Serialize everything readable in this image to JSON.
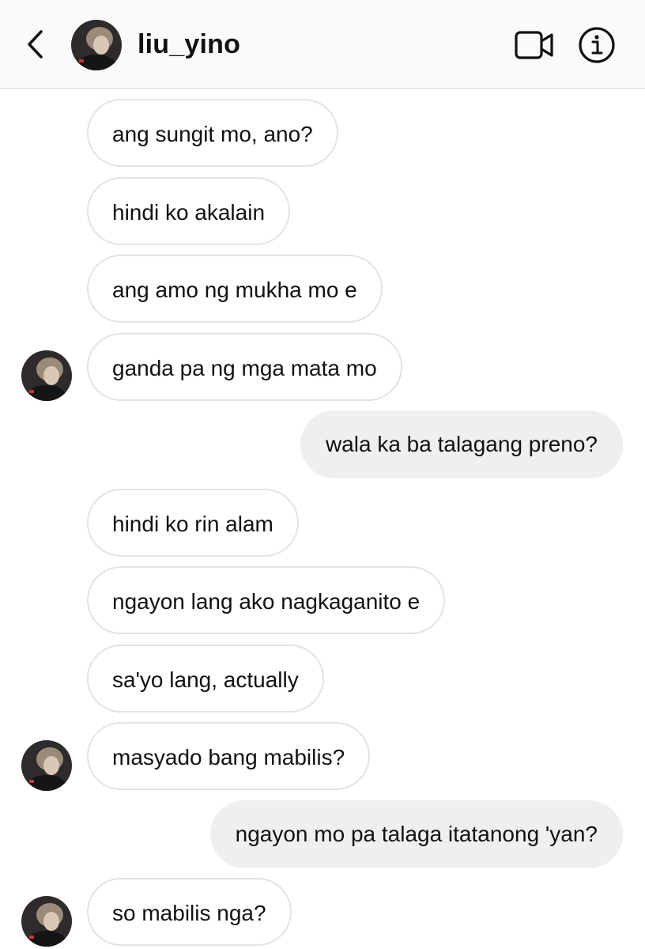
{
  "header": {
    "username": "liu_yino",
    "icons": {
      "back": "chevron-left-icon",
      "video": "video-camera-icon",
      "info": "info-icon"
    }
  },
  "colors": {
    "header_bg": "#fafafa",
    "incoming_bubble_bg": "#ffffff",
    "incoming_bubble_border": "#e3e3e3",
    "outgoing_bubble_bg": "#efefef",
    "text": "#111111"
  },
  "messages": [
    {
      "sender": "them",
      "text": "ang sungit mo, ano?"
    },
    {
      "sender": "them",
      "text": "hindi ko akalain"
    },
    {
      "sender": "them",
      "text": "ang amo ng mukha mo e"
    },
    {
      "sender": "them",
      "text": "ganda pa ng mga mata mo",
      "show_avatar": true
    },
    {
      "sender": "me",
      "text": "wala ka ba talagang preno?"
    },
    {
      "sender": "them",
      "text": "hindi ko rin alam"
    },
    {
      "sender": "them",
      "text": "ngayon lang ako nagkaganito e"
    },
    {
      "sender": "them",
      "text": "sa'yo lang, actually"
    },
    {
      "sender": "them",
      "text": "masyado bang mabilis?",
      "show_avatar": true
    },
    {
      "sender": "me",
      "text": "ngayon mo pa talaga itatanong 'yan?"
    },
    {
      "sender": "them",
      "text": "so mabilis nga?",
      "show_avatar": true
    }
  ]
}
